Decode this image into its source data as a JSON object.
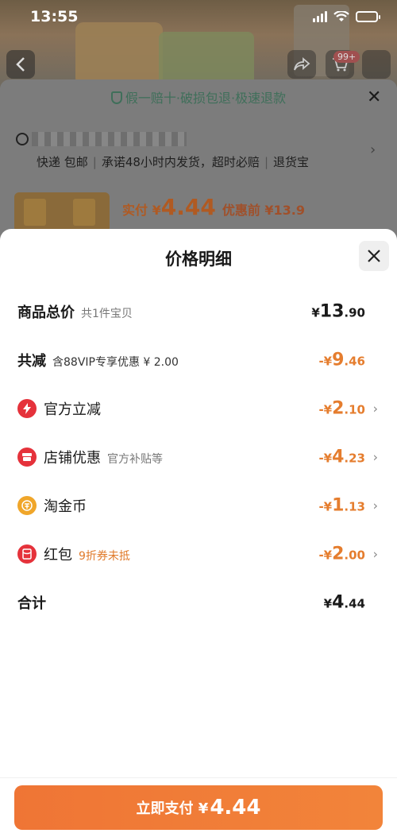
{
  "status_bar": {
    "time": "13:55"
  },
  "background": {
    "cart_badge": "99+",
    "guarantee_text": "假一赔十·破损包退·极速退款",
    "delivery": {
      "method": "快递 包邮",
      "promise": "承诺48小时内发货，超时必赔",
      "return": "退货宝"
    },
    "pay_prefix": "实付 ¥",
    "pay_amount": "4.44",
    "pre_discount": "优惠前 ¥13.9"
  },
  "sheet": {
    "title": "价格明细",
    "rows": [
      {
        "label": "商品总价",
        "sub": "共1件宝贝",
        "value_prefix": "¥",
        "value_int": "13",
        "value_dec": ".90"
      },
      {
        "label": "共减",
        "sub": "含88VIP专享优惠 ¥ 2.00",
        "value_prefix": "-¥",
        "value_int": "9",
        "value_dec": ".46"
      },
      {
        "label": "官方立减",
        "sub": "",
        "value_prefix": "-¥",
        "value_int": "2",
        "value_dec": ".10",
        "icon": "lightning-icon"
      },
      {
        "label": "店铺优惠",
        "sub": "官方补贴等",
        "value_prefix": "-¥",
        "value_int": "4",
        "value_dec": ".23",
        "icon": "store-icon"
      },
      {
        "label": "淘金币",
        "sub": "",
        "value_prefix": "-¥",
        "value_int": "1",
        "value_dec": ".13",
        "icon": "coin-icon"
      },
      {
        "label": "红包",
        "sub": "9折券未抵",
        "value_prefix": "-¥",
        "value_int": "2",
        "value_dec": ".00",
        "icon": "red-packet-icon"
      },
      {
        "label": "合计",
        "sub": "",
        "value_prefix": "¥",
        "value_int": "4",
        "value_dec": ".44"
      }
    ],
    "pay_button": {
      "label": "立即支付 ¥",
      "amount": "4.44"
    }
  },
  "colors": {
    "accent_orange": "#ef7535",
    "discount_orange": "#e57d2e",
    "icon_red": "#e5323b",
    "coin_gold": "#f0a62a"
  }
}
